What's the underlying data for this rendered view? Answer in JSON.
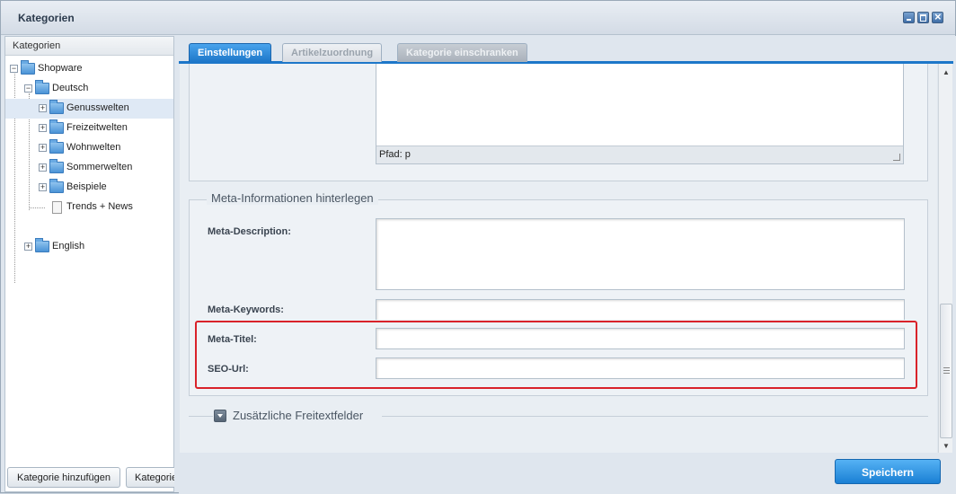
{
  "window": {
    "title": "Kategorien"
  },
  "tree": {
    "header": "Kategorien",
    "nodes": [
      {
        "label": "Shopware"
      },
      {
        "label": "Deutsch"
      },
      {
        "label": "Genusswelten"
      },
      {
        "label": "Freizeitwelten"
      },
      {
        "label": "Wohnwelten"
      },
      {
        "label": "Sommerwelten"
      },
      {
        "label": "Beispiele"
      },
      {
        "label": "Trends + News"
      },
      {
        "label": "English"
      }
    ],
    "buttons": {
      "add": "Kategorie hinzufügen",
      "second": "Kategorie"
    }
  },
  "tabs": [
    {
      "label": "Einstellungen"
    },
    {
      "label": "Artikelzuordnung"
    },
    {
      "label": "Kategorie einschranken"
    }
  ],
  "editor": {
    "path_label": "Pfad: p"
  },
  "meta": {
    "legend": "Meta-Informationen hinterlegen",
    "description_label": "Meta-Description:",
    "description_value": "",
    "keywords_label": "Meta-Keywords:",
    "keywords_value": "",
    "title_label": "Meta-Titel:",
    "title_value": "",
    "seo_label": "SEO-Url:",
    "seo_value": ""
  },
  "extra": {
    "legend": "Zusätzliche Freitextfelder"
  },
  "footer": {
    "save_label": "Speichern"
  },
  "colors": {
    "accent": "#1d77c9",
    "highlight": "#d9222a"
  }
}
